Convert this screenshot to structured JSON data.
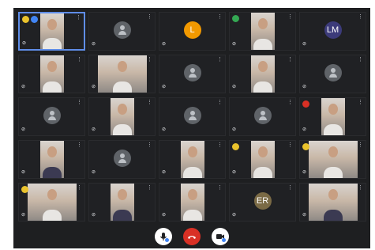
{
  "tiles": [
    {
      "name": "tile-1",
      "type": "video",
      "active": true,
      "badge": "yellow",
      "badge2": "blue"
    },
    {
      "name": "tile-2",
      "type": "avatar"
    },
    {
      "name": "tile-3",
      "type": "initial",
      "initial": "L",
      "color": "#f29900"
    },
    {
      "name": "tile-4",
      "type": "video",
      "badge": "green"
    },
    {
      "name": "tile-5",
      "type": "initial",
      "initial": "LM",
      "color": "#3c3b7a"
    },
    {
      "name": "tile-6",
      "type": "video"
    },
    {
      "name": "tile-7",
      "type": "video",
      "wide": true
    },
    {
      "name": "tile-8",
      "type": "avatar"
    },
    {
      "name": "tile-9",
      "type": "video"
    },
    {
      "name": "tile-10",
      "type": "avatar"
    },
    {
      "name": "tile-11",
      "type": "avatar"
    },
    {
      "name": "tile-12",
      "type": "video"
    },
    {
      "name": "tile-13",
      "type": "avatar"
    },
    {
      "name": "tile-14",
      "type": "avatar"
    },
    {
      "name": "tile-15",
      "type": "video",
      "badge": "red"
    },
    {
      "name": "tile-16",
      "type": "video",
      "dark": true
    },
    {
      "name": "tile-17",
      "type": "avatar"
    },
    {
      "name": "tile-18",
      "type": "video"
    },
    {
      "name": "tile-19",
      "type": "video",
      "badge": "yellow"
    },
    {
      "name": "tile-20",
      "type": "video",
      "wide": true,
      "badge": "yellow"
    },
    {
      "name": "tile-21",
      "type": "video",
      "wide": true,
      "badge": "yellow"
    },
    {
      "name": "tile-22",
      "type": "video",
      "dark": true
    },
    {
      "name": "tile-23",
      "type": "video"
    },
    {
      "name": "tile-24",
      "type": "initial",
      "initial": "ER",
      "color": "#7a6a45"
    },
    {
      "name": "tile-25",
      "type": "video",
      "wide": true,
      "dark": true
    }
  ],
  "controls": {
    "mic": {
      "icon": "mic-off-icon"
    },
    "hangup": {
      "icon": "hang-up-icon",
      "color": "#d93025"
    },
    "camera": {
      "icon": "camera-off-icon"
    }
  }
}
